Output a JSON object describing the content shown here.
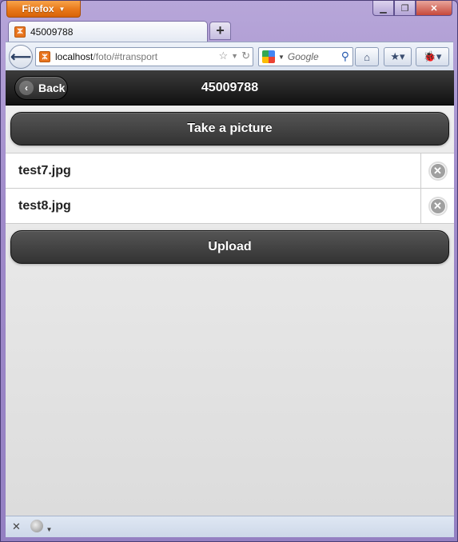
{
  "browser": {
    "menu_button": "Firefox",
    "tab_title": "45009788",
    "url_host": "localhost",
    "url_path": "/foto/#transport",
    "search_placeholder": "Google"
  },
  "header": {
    "title": "45009788",
    "back_label": "Back"
  },
  "buttons": {
    "take_picture": "Take a picture",
    "upload": "Upload"
  },
  "files": [
    {
      "name": "test7.jpg"
    },
    {
      "name": "test8.jpg"
    }
  ],
  "colors": {
    "header_bg": "#111111",
    "button_bg": "#3a3a3a",
    "firefox_orange": "#e8781a"
  }
}
